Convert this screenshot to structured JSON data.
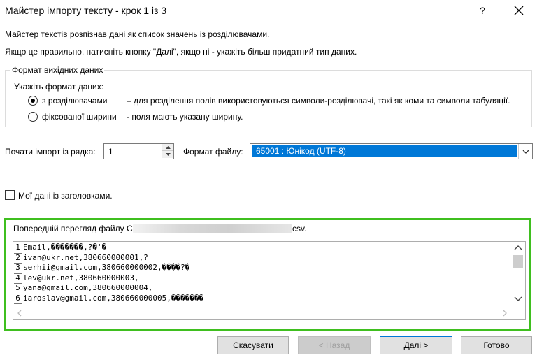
{
  "window": {
    "title": "Майстер імпорту тексту - крок 1 із 3",
    "help": "?"
  },
  "intro": {
    "line1": "Майстер текстів розпізнав дані як список значень із розділювачами.",
    "line2": "Якщо це правильно, натисніть кнопку \"Далі\", якщо ні - укажіть більш придатний тип даних."
  },
  "source_format": {
    "legend": "Формат вихідних даних",
    "prompt": "Укажіть формат даних:",
    "options": [
      {
        "label": "з розділювачами",
        "desc": "– для розділення полів використовуються символи-розділювачі, такі як коми та символи табуляції.",
        "checked": true
      },
      {
        "label": "фіксованої ширини",
        "desc": "- поля мають указану ширину.",
        "checked": false
      }
    ]
  },
  "start_row": {
    "label": "Почати імпорт із рядка:",
    "value": "1"
  },
  "file_format": {
    "label": "Формат файлу:",
    "value": "65001 : Юнікод (UTF-8)"
  },
  "headers_checkbox": {
    "label": "Мої дані із заголовками.",
    "checked": false
  },
  "preview": {
    "label_prefix": "Попередній перегляд файлу C:\\",
    "label_suffix": "csv.",
    "rows": [
      {
        "num": "1",
        "text": "Email,�������,?�'�"
      },
      {
        "num": "2",
        "text": "ivan@ukr.net,380660000001,?"
      },
      {
        "num": "3",
        "text": "serhii@gmail.com,380660000002,����?�"
      },
      {
        "num": "4",
        "text": "lev@ukr.net,380660000003,"
      },
      {
        "num": "5",
        "text": "yana@gmail.com,380660000004,"
      },
      {
        "num": "6",
        "text": "iaroslav@gmail.com,380660000005,�������"
      }
    ]
  },
  "buttons": {
    "cancel": "Скасувати",
    "back": "< Назад",
    "next": "Далі >",
    "finish": "Готово"
  },
  "colors": {
    "accent": "#0078d7",
    "highlight_frame": "#3fbf1f"
  }
}
